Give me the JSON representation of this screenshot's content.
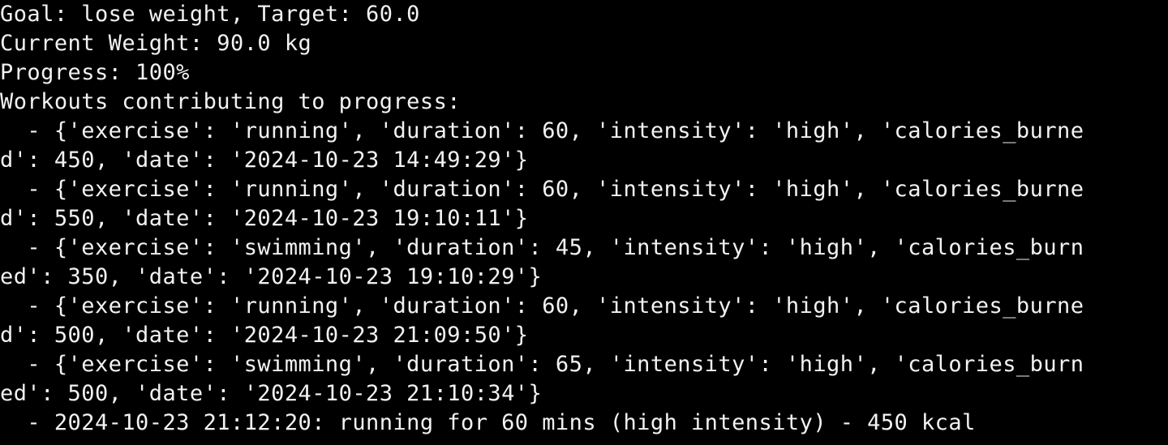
{
  "terminal": {
    "lines": [
      "Goal: lose weight, Target: 60.0",
      "Current Weight: 90.0 kg",
      "Progress: 100%",
      "Workouts contributing to progress:",
      "  - {'exercise': 'running', 'duration': 60, 'intensity': 'high', 'calories_burne",
      "d': 450, 'date': '2024-10-23 14:49:29'}",
      "  - {'exercise': 'running', 'duration': 60, 'intensity': 'high', 'calories_burne",
      "d': 550, 'date': '2024-10-23 19:10:11'}",
      "  - {'exercise': 'swimming', 'duration': 45, 'intensity': 'high', 'calories_burn",
      "ed': 350, 'date': '2024-10-23 19:10:29'}",
      "  - {'exercise': 'running', 'duration': 60, 'intensity': 'high', 'calories_burne",
      "d': 500, 'date': '2024-10-23 21:09:50'}",
      "  - {'exercise': 'swimming', 'duration': 65, 'intensity': 'high', 'calories_burn",
      "ed': 500, 'date': '2024-10-23 21:10:34'}",
      "  - 2024-10-23 21:12:20: running for 60 mins (high intensity) - 450 kcal"
    ]
  }
}
